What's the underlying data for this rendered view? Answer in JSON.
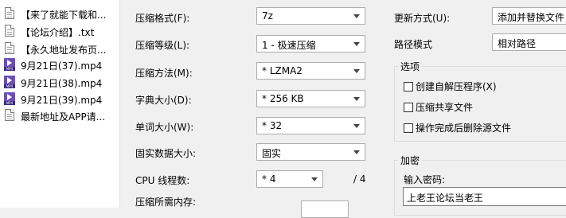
{
  "files": [
    {
      "name": "【来了就能下载和...",
      "icon": "text-file-icon"
    },
    {
      "name": "【论坛介绍】.txt",
      "icon": "text-file-icon"
    },
    {
      "name": "【永久地址发布页...",
      "icon": "text-file-icon"
    },
    {
      "name": "9月21日(37).mp4",
      "icon": "mp4-file-icon"
    },
    {
      "name": "9月21日(38).mp4",
      "icon": "mp4-file-icon"
    },
    {
      "name": "9月21日(39).mp4",
      "icon": "mp4-file-icon"
    },
    {
      "name": "最新地址及APP请...",
      "icon": "text-file-icon"
    }
  ],
  "mp4_badge": "MP4",
  "form": {
    "format_label": "压缩格式(F):",
    "format_value": "7z",
    "level_label": "压缩等级(L):",
    "level_value": "1 - 极速压缩",
    "method_label": "压缩方法(M):",
    "method_value": "* LZMA2",
    "dict_label": "字典大小(D):",
    "dict_value": "* 256 KB",
    "word_label": "单词大小(W):",
    "word_value": "* 32",
    "solid_label": "固实数据大小:",
    "solid_value": "固实",
    "cpu_label": "CPU 线程数:",
    "cpu_value": "* 4",
    "cpu_total": "/ 4",
    "memory_label": "压缩所需内存:"
  },
  "right": {
    "update_label": "更新方式(U):",
    "update_value": "添加并替换文件",
    "path_label": "路径模式",
    "path_value": "相对路径",
    "options_title": "选项",
    "options": [
      {
        "label": "创建自解压程序(X)",
        "checked": false
      },
      {
        "label": "压缩共享文件",
        "checked": false
      },
      {
        "label": "操作完成后删除源文件",
        "checked": false
      }
    ],
    "encrypt_title": "加密",
    "password_label": "输入密码:",
    "password_value": "上老王论坛当老王"
  }
}
